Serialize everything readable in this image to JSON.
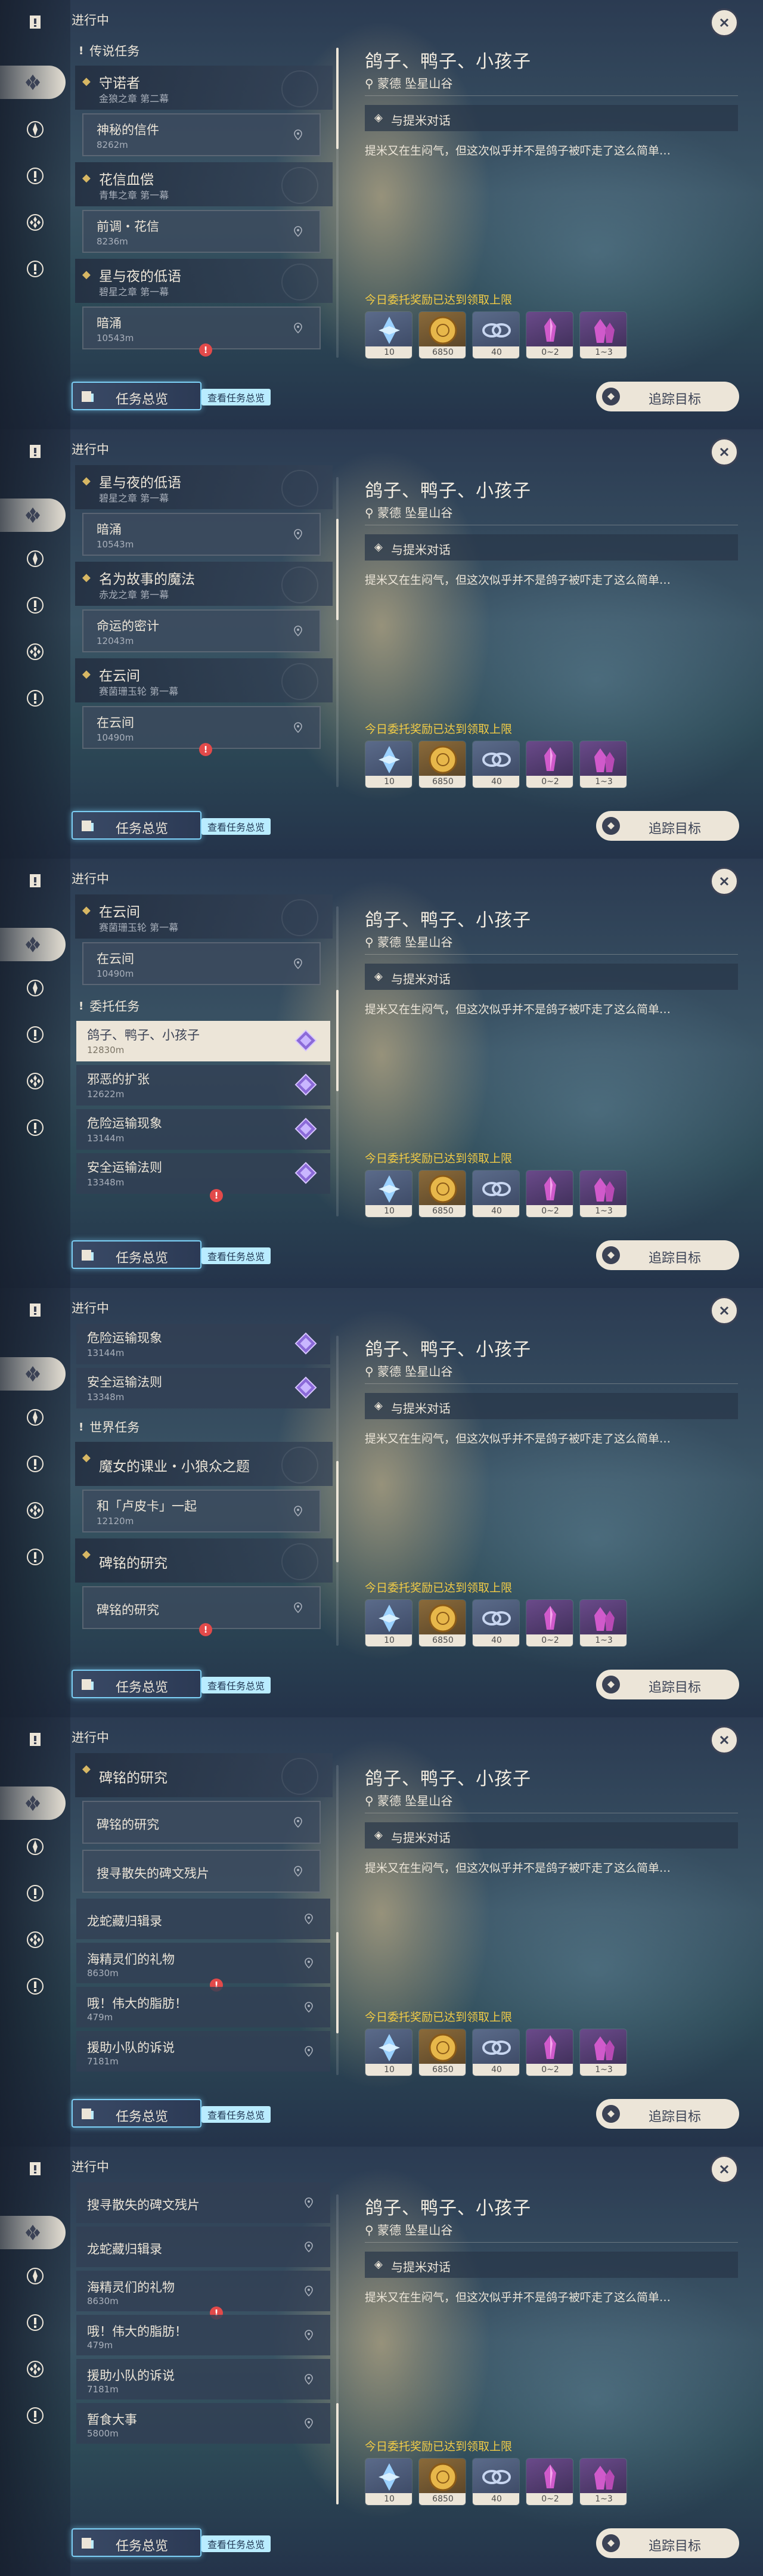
{
  "ongoing": "进行中",
  "overview_label": "任务总览",
  "overview_tag": "查看任务总览",
  "detail": {
    "title": "鸽子、鸭子、小孩子",
    "location": "蒙德 坠星山谷",
    "goal": "与提米对话",
    "description": "提米又在生闷气，但这次似乎并不是鸽子被吓走了这么简单…",
    "reward_warning": "今日委托奖励已达到领取上限",
    "rewards": [
      {
        "icon": "adventure-exp-icon",
        "count": "10"
      },
      {
        "icon": "mora-icon",
        "count": "6850"
      },
      {
        "icon": "friendship-exp-icon",
        "count": "40"
      },
      {
        "icon": "crystal-small-icon",
        "count": "0~2"
      },
      {
        "icon": "crystal-large-icon",
        "count": "1~3"
      }
    ],
    "track_label": "追踪目标"
  },
  "panels": [
    {
      "rows": [
        {
          "k": "cat",
          "label": "传说任务"
        },
        {
          "k": "head",
          "title": "守诺者",
          "sub": "金狼之章 第二幕"
        },
        {
          "k": "sub",
          "title": "神秘的信件",
          "dist": "8262m"
        },
        {
          "k": "head",
          "title": "花信血偿",
          "sub": "青隼之章 第一幕"
        },
        {
          "k": "sub",
          "title": "前调・花信",
          "dist": "8236m"
        },
        {
          "k": "head",
          "title": "星与夜的低语",
          "sub": "碧星之章 第一幕"
        },
        {
          "k": "sub",
          "title": "暗涌",
          "dist": "10543m",
          "alert": true
        }
      ]
    },
    {
      "rows": [
        {
          "k": "head",
          "title": "星与夜的低语",
          "sub": "碧星之章 第一幕"
        },
        {
          "k": "sub",
          "title": "暗涌",
          "dist": "10543m"
        },
        {
          "k": "head",
          "title": "名为故事的魔法",
          "sub": "赤龙之章 第一幕"
        },
        {
          "k": "sub",
          "title": "命运的密计",
          "dist": "12043m"
        },
        {
          "k": "head",
          "title": "在云间",
          "sub": "赛菌珊玉轮 第一幕"
        },
        {
          "k": "sub",
          "title": "在云间",
          "dist": "10490m",
          "alert": true
        }
      ]
    },
    {
      "rows": [
        {
          "k": "head",
          "title": "在云间",
          "sub": "赛菌珊玉轮 第一幕"
        },
        {
          "k": "sub",
          "title": "在云间",
          "dist": "10490m"
        },
        {
          "k": "cat",
          "label": "委托任务"
        },
        {
          "k": "comm",
          "title": "鸽子、鸭子、小孩子",
          "dist": "12830m",
          "sel": true
        },
        {
          "k": "comm",
          "title": "邪恶的扩张",
          "dist": "12622m"
        },
        {
          "k": "comm",
          "title": "危险运输现象",
          "dist": "13144m"
        },
        {
          "k": "comm",
          "title": "安全运输法则",
          "dist": "13348m",
          "alert": true
        }
      ]
    },
    {
      "rows": [
        {
          "k": "comm",
          "title": "危险运输现象",
          "dist": "13144m"
        },
        {
          "k": "comm",
          "title": "安全运输法则",
          "dist": "13348m"
        },
        {
          "k": "cat",
          "label": "世界任务"
        },
        {
          "k": "head",
          "title": "魔女的课业・小狼众之题",
          "sub": ""
        },
        {
          "k": "sub",
          "title": "和「卢皮卡」一起",
          "dist": "12120m"
        },
        {
          "k": "head",
          "title": "碑铭的研究",
          "sub": ""
        },
        {
          "k": "sub",
          "title": "碑铭的研究",
          "dist": "",
          "alert": true
        }
      ]
    },
    {
      "rows": [
        {
          "k": "head",
          "title": "碑铭的研究",
          "sub": ""
        },
        {
          "k": "sub",
          "title": "碑铭的研究",
          "dist": ""
        },
        {
          "k": "sub",
          "title": "搜寻散失的碑文残片",
          "dist": ""
        },
        {
          "k": "world",
          "title": "龙蛇藏归辑录",
          "dist": ""
        },
        {
          "k": "world",
          "title": "海精灵们的礼物",
          "dist": "8630m",
          "alert": true
        },
        {
          "k": "world",
          "title": "哦！伟大的脂肪！",
          "dist": "479m"
        },
        {
          "k": "world",
          "title": "援助小队的诉说",
          "dist": "7181m"
        }
      ]
    },
    {
      "rows": [
        {
          "k": "world",
          "title": "搜寻散失的碑文残片",
          "dist": ""
        },
        {
          "k": "world",
          "title": "龙蛇藏归辑录",
          "dist": ""
        },
        {
          "k": "world",
          "title": "海精灵们的礼物",
          "dist": "8630m",
          "alert": true
        },
        {
          "k": "world",
          "title": "哦！伟大的脂肪！",
          "dist": "479m"
        },
        {
          "k": "world",
          "title": "援助小队的诉说",
          "dist": "7181m"
        },
        {
          "k": "world",
          "title": "暂食大事",
          "dist": "5800m"
        }
      ]
    }
  ]
}
